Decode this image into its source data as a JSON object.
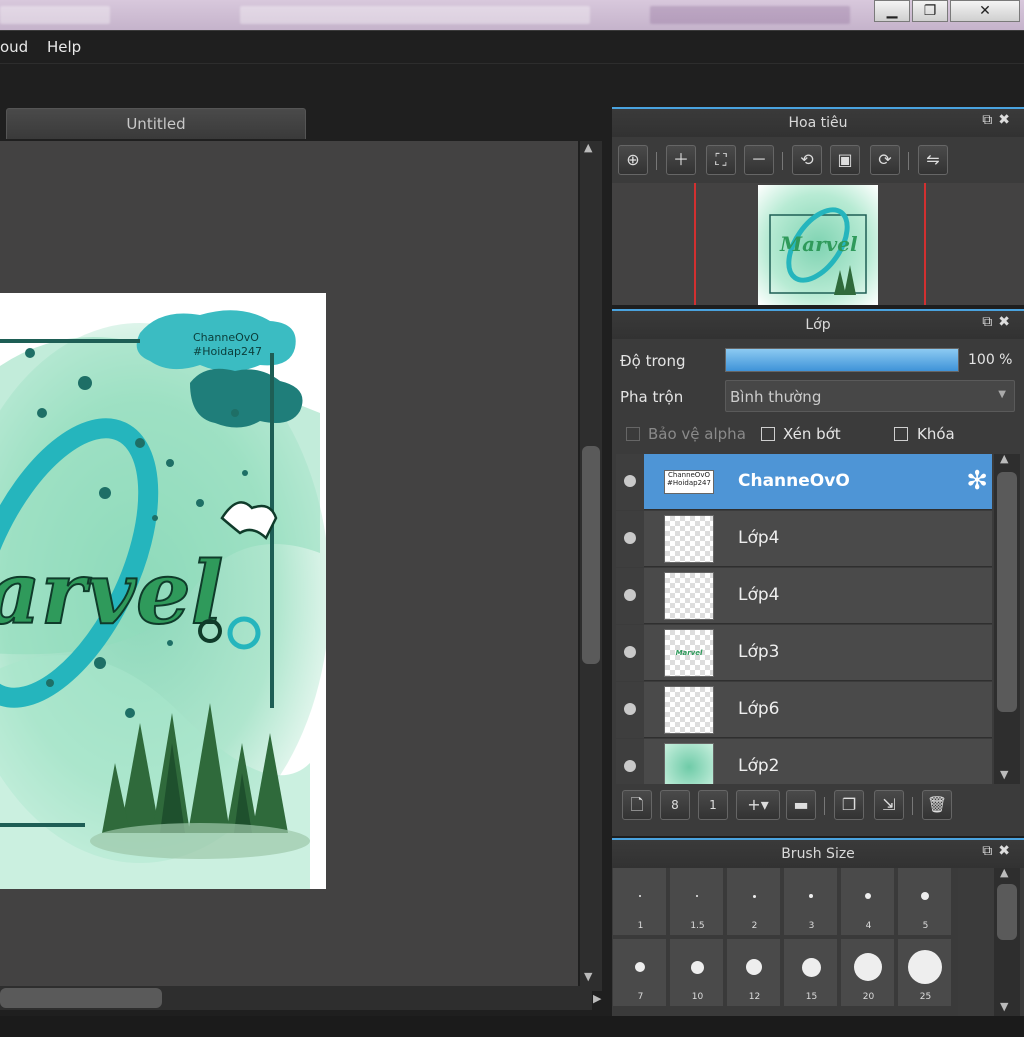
{
  "menu": {
    "items": [
      "oud",
      "Help"
    ]
  },
  "window_controls": {
    "minimize": "▁",
    "restore": "❐",
    "close": "✕"
  },
  "document": {
    "tab_title": "Untitled"
  },
  "artwork": {
    "watermark_line1": "ChanneOvO",
    "watermark_line2": "#Hoidap247",
    "title_text": "arvel"
  },
  "navigator": {
    "title": "Hoa tiêu",
    "tools": [
      "zoom-fit-icon",
      "zoom-in-icon",
      "fit-screen-icon",
      "zoom-out-icon",
      "rotate-left-icon",
      "actual-size-icon",
      "rotate-right-icon",
      "flip-icon"
    ]
  },
  "layers": {
    "title": "Lớp",
    "opacity_label": "Độ trong",
    "opacity_value": "100 %",
    "opacity_fraction": 1.0,
    "blend_label": "Pha trộn",
    "blend_value": "Bình thường",
    "protect_alpha_label": "Bảo vệ alpha",
    "clipping_label": "Xén bớt",
    "lock_label": "Khóa",
    "items": [
      {
        "name": "ChanneOvO",
        "active": true,
        "thumb_text": "ChanneOvO #Hoidap247"
      },
      {
        "name": "Lớp4",
        "active": false
      },
      {
        "name": "Lớp4",
        "active": false
      },
      {
        "name": "Lớp3",
        "active": false,
        "thumb_text": "Marvel"
      },
      {
        "name": "Lớp6",
        "active": false
      },
      {
        "name": "Lớp2",
        "active": false
      }
    ]
  },
  "brush_size": {
    "title": "Brush Size",
    "sizes": [
      "1",
      "1.5",
      "2",
      "3",
      "4",
      "5",
      "7",
      "10",
      "12",
      "15",
      "20",
      "25"
    ]
  },
  "colors": {
    "accent": "#4aa3df",
    "active_layer": "#4e95d6"
  }
}
